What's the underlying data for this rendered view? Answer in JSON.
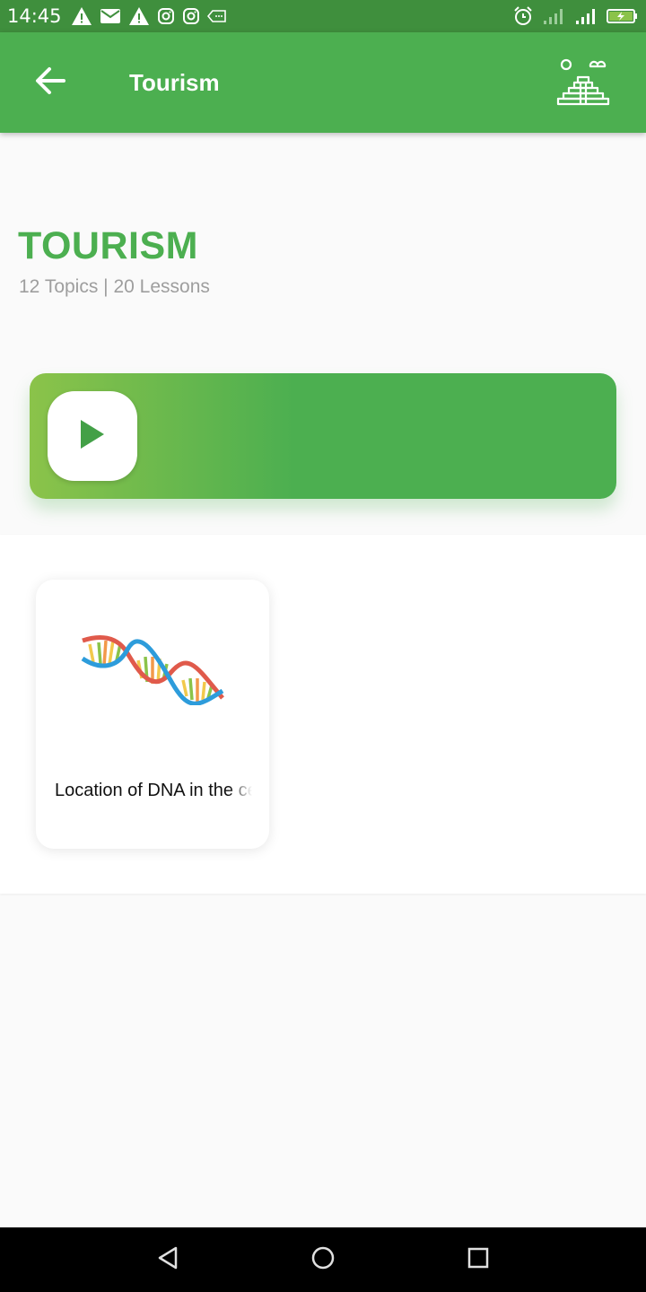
{
  "status_bar": {
    "time": "14:45",
    "left_icons": [
      "warning-icon",
      "mail-icon",
      "warning-icon",
      "instagram-icon",
      "instagram-icon",
      "message-icon"
    ],
    "right_icons": [
      "alarm-icon",
      "signal-icon",
      "signal-icon",
      "battery-charging-icon"
    ]
  },
  "app_bar": {
    "title": "Tourism",
    "back_icon": "arrow-left-icon",
    "logo_icon": "pyramid-icon"
  },
  "header": {
    "heading": "TOURISM",
    "subtitle": "12 Topics | 20 Lessons"
  },
  "banner": {
    "play_icon": "play-icon"
  },
  "lessons": [
    {
      "title": "Location of DNA in the cell",
      "image": "dna-icon"
    }
  ],
  "nav_bar": {
    "icons": [
      "back-triangle-icon",
      "home-circle-icon",
      "recents-square-icon"
    ]
  },
  "colors": {
    "primary": "#4caf50",
    "status_bar": "#3f8f3d",
    "accent_light": "#8bc34a",
    "subtitle_gray": "#9e9e9e"
  }
}
